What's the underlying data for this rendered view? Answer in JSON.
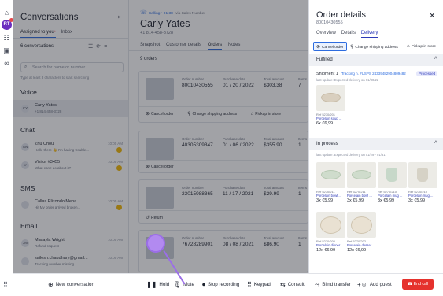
{
  "rail": {
    "avatar_initials": "RT"
  },
  "conversations": {
    "title": "Conversations",
    "tab_assigned": "Assigned to you",
    "tab_inbox": "Inbox",
    "count": "6 conversations",
    "search_placeholder": "Search for name or number",
    "hint": "Type at least 3 characters to start searching",
    "voice_label": "Voice",
    "voice_items": [
      {
        "initials": "CY",
        "name": "Carly Yates",
        "sub": "+1 814-458-3728"
      }
    ],
    "chat_label": "Chat",
    "chat_items": [
      {
        "initials": "AN",
        "name": "Zhu Chou",
        "sub": "Hello there 👋 I'm having trouble...",
        "time": "10:00 AM"
      },
      {
        "initials": "V",
        "name": "Visitor #3455",
        "sub": "What can I do about it?",
        "time": "10:00 AM"
      }
    ],
    "sms_label": "SMS",
    "sms_items": [
      {
        "initials": "",
        "name": "Callas Elizondo Mena",
        "sub": "Hi! My order arrived broken...",
        "time": "10:00 AM"
      }
    ],
    "email_label": "Email",
    "email_items": [
      {
        "initials": "JM",
        "name": "Macayla Wright",
        "sub": "Refund request",
        "time": "10:00 AM"
      },
      {
        "initials": "",
        "name": "sailesh.chaudhary@gmail...",
        "sub": "Tracking number missing",
        "time": "10:00 AM"
      }
    ]
  },
  "contact": {
    "meta_status": "Calling • 01:38",
    "meta_via": "via Sales Number",
    "name": "Carly Yates",
    "phone": "+1 814-458-3728",
    "tabs": [
      "Snapshot",
      "Customer details",
      "Orders",
      "Notes"
    ],
    "orders_label": "9 orders",
    "order_head_number": "Order number",
    "order_head_date": "Purchase date",
    "order_head_total": "Total amount",
    "order_head_items": "Items",
    "orders": [
      {
        "number": "80010430555",
        "date": "01 / 20 / 2022",
        "total": "$303.38",
        "items": "7"
      },
      {
        "number": "40305309347",
        "date": "01 / 06 / 2022",
        "total": "$355.90",
        "items": "1"
      },
      {
        "number": "23015988365",
        "date": "11 / 17 / 2021",
        "total": "$29.99",
        "items": "1"
      },
      {
        "number": "76728289901",
        "date": "08 / 08 / 2021",
        "total": "$86.90",
        "items": "1"
      }
    ],
    "action_cancel": "Cancel order",
    "action_change": "Change shipping address",
    "action_pickup": "Pickup in store",
    "action_return": "Return"
  },
  "details": {
    "title": "Order details",
    "order_id": "80010430555",
    "tabs": [
      "Overview",
      "Details",
      "Delivery"
    ],
    "btn_cancel": "Cancel order",
    "btn_change": "Change shipping address",
    "btn_pickup": "Pickup in store",
    "fulfilled_label": "Fulfilled",
    "shipment": "Shipment 1",
    "tracking": "Tracking n. #USPS 24339482904809482",
    "status": "Processed",
    "last_update": "last update: Expected delivery on 01/30/22",
    "fulfilled_item": {
      "ref": "Ref 5270/201",
      "name": "Porcelain soup ...",
      "qty": "6x €6,99"
    },
    "in_process_label": "In process",
    "in_process_update": "last update: Expected delivery on 01/29 - 01/31",
    "in_process_items": [
      {
        "ref": "Ref 5270/211",
        "name": "Porcelain bowl ...",
        "qty": "3x €5,99"
      },
      {
        "ref": "Ref 5270/211",
        "name": "Porcelain bowl ...",
        "qty": "3x €5,99"
      },
      {
        "ref": "Ref 5270/210",
        "name": "Porcelain mug ...",
        "qty": "3x €5,99"
      },
      {
        "ref": "Ref 5270/210",
        "name": "Porcelain mug ...",
        "qty": "3x €5,99"
      },
      {
        "ref": "Ref 5270/200",
        "name": "Porcelain dinner...",
        "qty": "12x €6,99"
      },
      {
        "ref": "Ref 5270/202",
        "name": "Porcelain desser...",
        "qty": "12x €6,99"
      }
    ]
  },
  "callbar": {
    "new_conversation": "New conversation",
    "hold": "Hold",
    "mute": "Mute",
    "stop_recording": "Stop recording",
    "keypad": "Keypad",
    "consult": "Consult",
    "blind_transfer": "Blind transfer",
    "add_guest": "Add guest",
    "end_call": "End call"
  },
  "colors": {
    "accent": "#2d6cdf",
    "brand": "#6b2fbf",
    "end_call": "#e5322d",
    "status_indigo": "#2d3ab8"
  }
}
